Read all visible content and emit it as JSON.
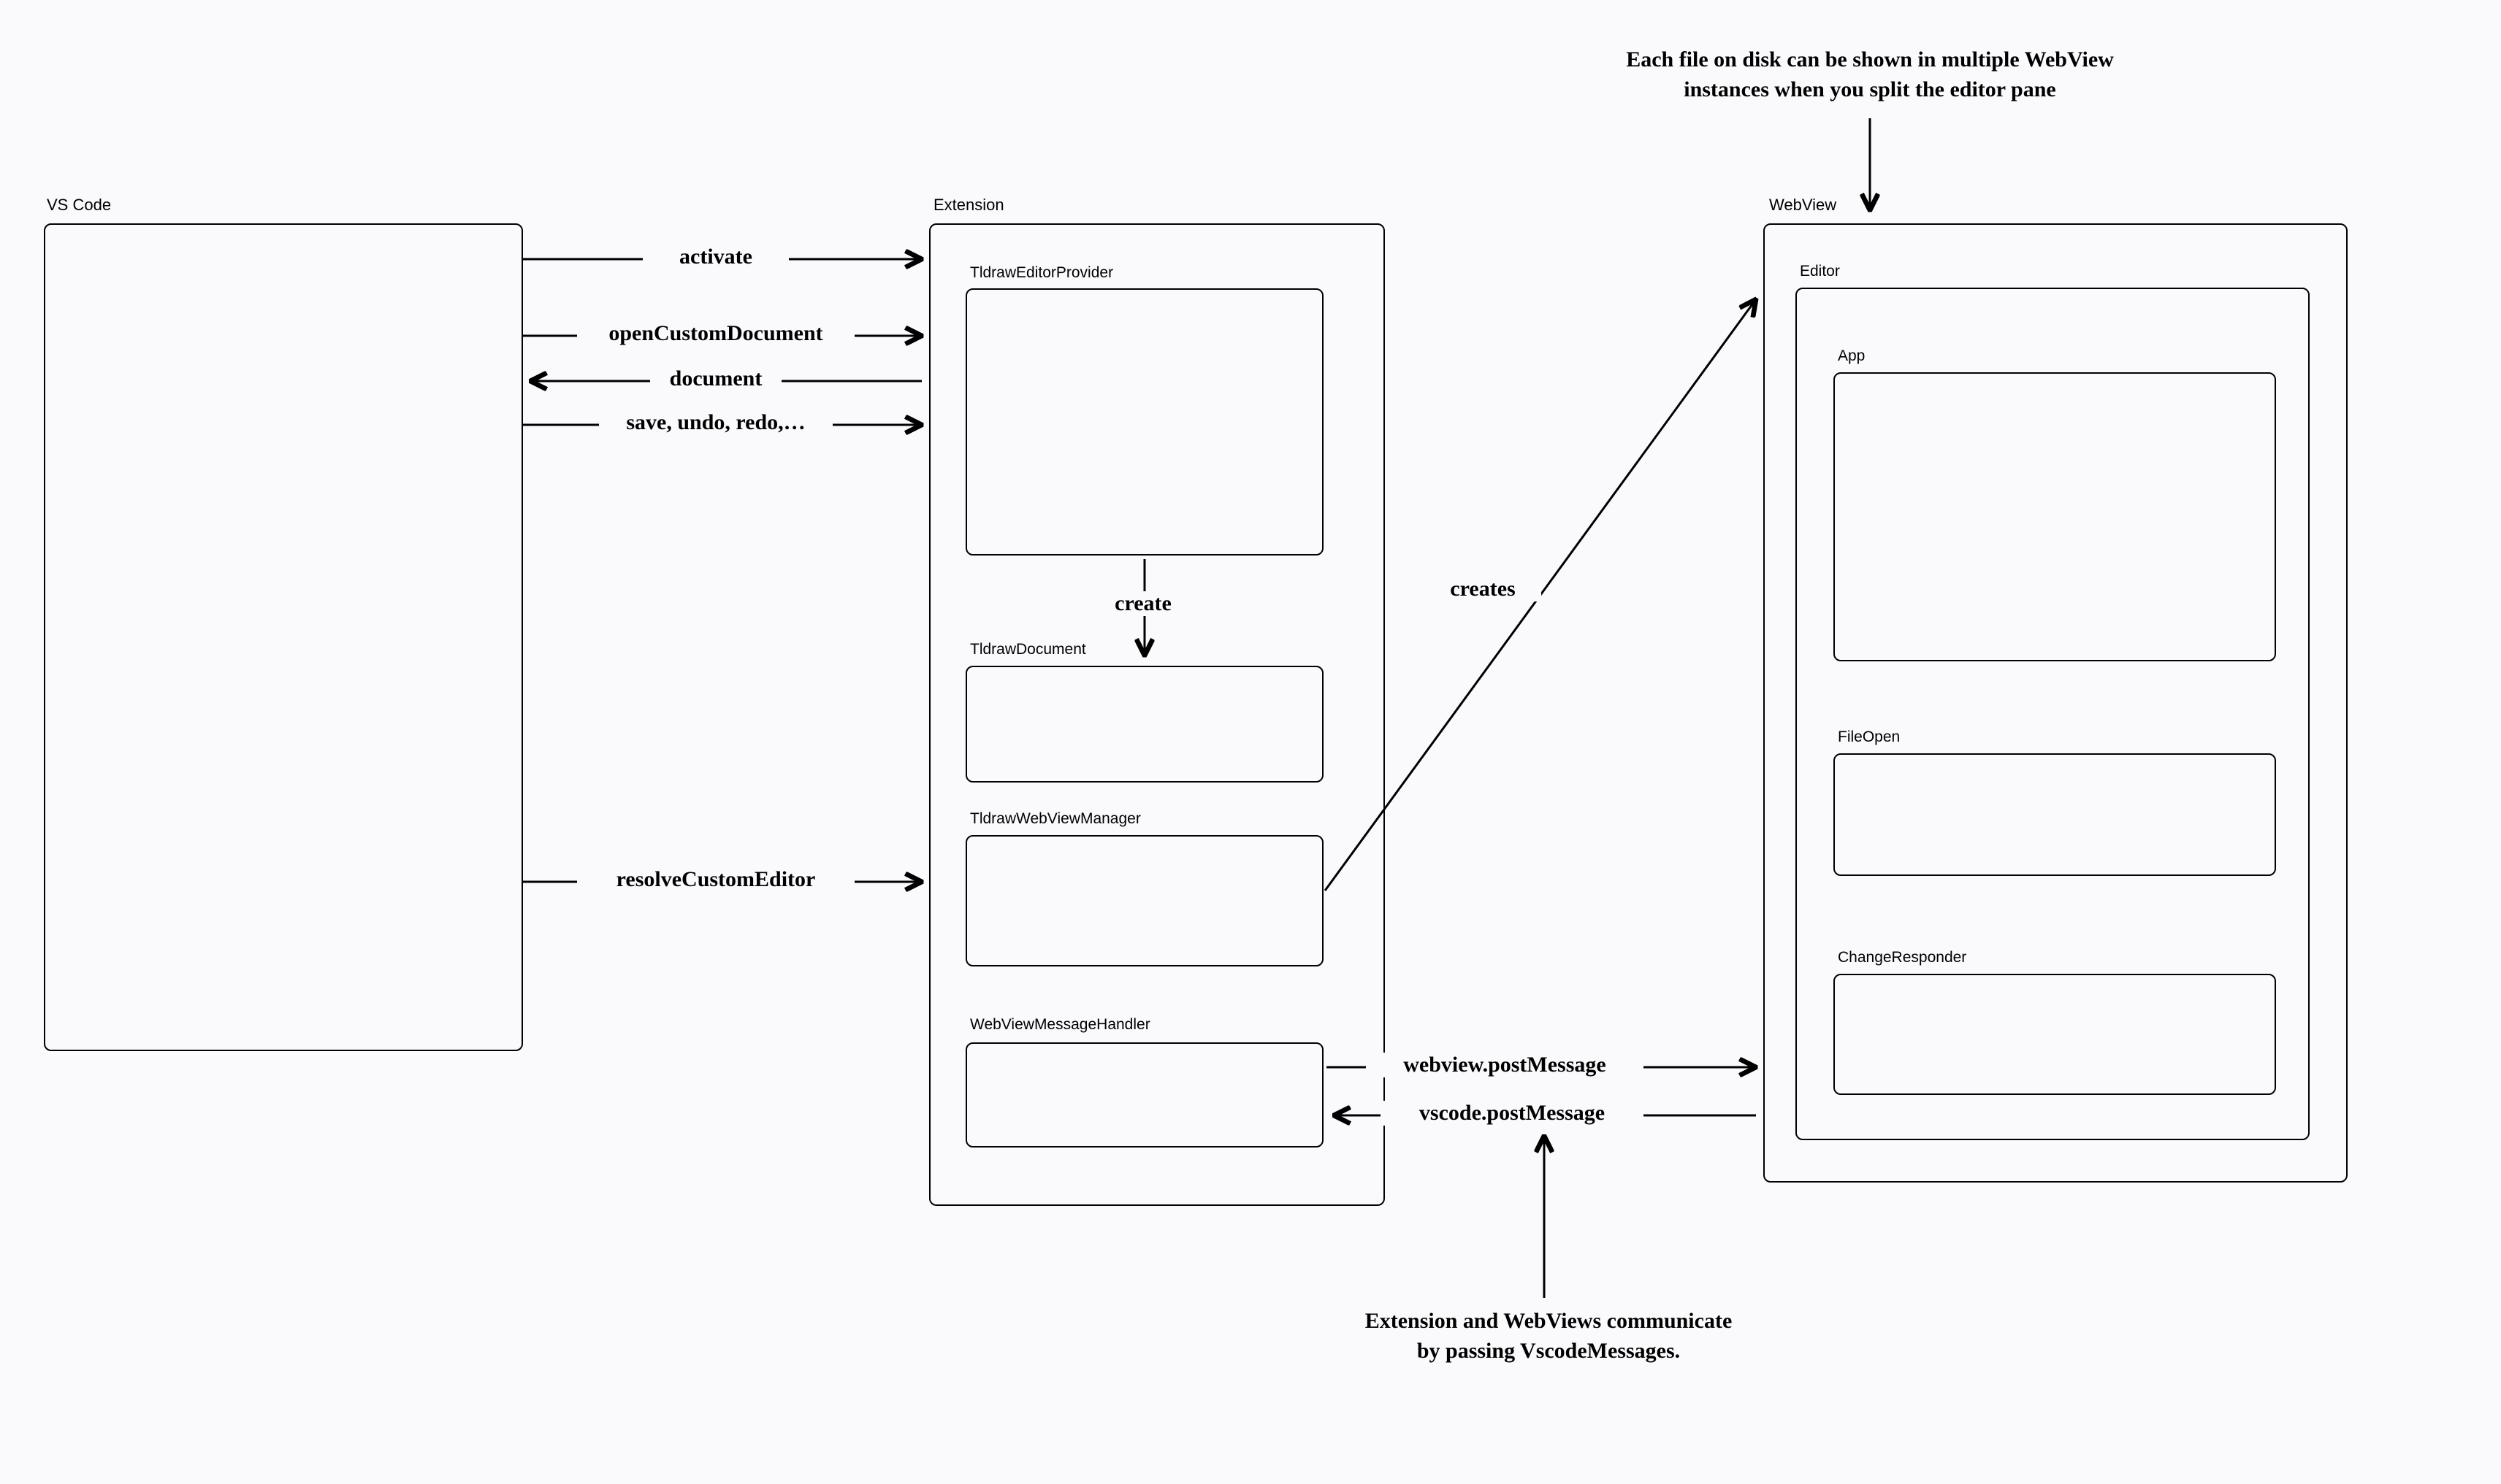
{
  "annotations": {
    "top": "Each file on disk can be shown in multiple WebView\ninstances when you split the editor pane",
    "bottom": "Extension and WebViews communicate\nby passing VscodeMessages."
  },
  "containers": {
    "vscode": {
      "title": "VS Code"
    },
    "extension": {
      "title": "Extension",
      "children": {
        "provider": "TldrawEditorProvider",
        "document": "TldrawDocument",
        "webviewManager": "TldrawWebViewManager",
        "messageHandler": "WebViewMessageHandler"
      }
    },
    "webview": {
      "title": "WebView",
      "editor": {
        "title": "Editor",
        "children": {
          "app": "App",
          "fileOpen": "FileOpen",
          "changeResponder": "ChangeResponder"
        }
      }
    }
  },
  "edges": {
    "activate": "activate",
    "openCustomDocument": "openCustomDocument",
    "document": "document",
    "saveUndoRedo": "save, undo, redo,…",
    "resolveCustomEditor": "resolveCustomEditor",
    "create": "create",
    "creates": "creates",
    "webviewPost": "webview.postMessage",
    "vscodePost": "vscode.postMessage"
  }
}
